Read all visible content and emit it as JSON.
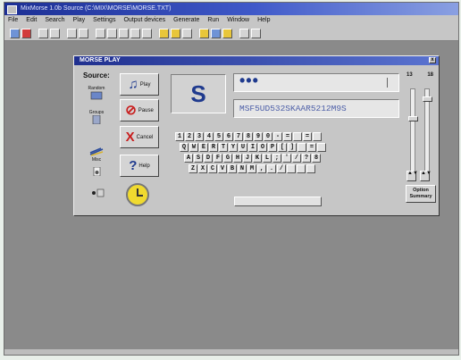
{
  "app": {
    "title": "MixMorse 1.0b Source (C:\\MIX\\MORSE\\MORSE.TXT)"
  },
  "menubar": [
    {
      "label": "File"
    },
    {
      "label": "Edit"
    },
    {
      "label": "Search"
    },
    {
      "label": "Play"
    },
    {
      "label": "Settings"
    },
    {
      "label": "Output devices"
    },
    {
      "label": "Generate"
    },
    {
      "label": "Run"
    },
    {
      "label": "Window"
    },
    {
      "label": "Help"
    }
  ],
  "dialog": {
    "title": "MORSE PLAY",
    "close_glyph": "x",
    "source_label": "Source:",
    "source_buttons": [
      {
        "label": "Random",
        "icon": "random-dice-icon"
      },
      {
        "label": "Groups",
        "icon": "groups-icon"
      },
      {
        "label": "Misc",
        "icon": "misc-icon"
      },
      {
        "label": "",
        "icon": "file-icon"
      },
      {
        "label": "",
        "icon": "toggle-icon"
      }
    ],
    "commands": [
      {
        "label": "Play",
        "glyph": "♫",
        "icon": "play-music-icon",
        "color": "#1f3a8e"
      },
      {
        "label": "Pause",
        "glyph": "⊘",
        "icon": "pause-circle-icon",
        "color": "#c81e1e"
      },
      {
        "label": "Cancel",
        "glyph": "X",
        "icon": "cancel-x-icon",
        "color": "#c81e1e"
      },
      {
        "label": "Help",
        "glyph": "?",
        "icon": "help-question-icon",
        "color": "#1f3a8e"
      }
    ],
    "current_char": "S",
    "morse_code": "•••",
    "text_output": "MSF5UD532SKAAR5212M9S",
    "keyboard": {
      "row1": [
        "1",
        "2",
        "3",
        "4",
        "5",
        "6",
        "7",
        "8",
        "9",
        "0",
        "-",
        "=",
        "",
        "=",
        ""
      ],
      "row2": [
        "Q",
        "W",
        "E",
        "R",
        "T",
        "Y",
        "U",
        "I",
        "O",
        "P",
        "[",
        "]",
        "",
        "=",
        ""
      ],
      "row3": [
        "A",
        "S",
        "D",
        "F",
        "G",
        "H",
        "J",
        "K",
        "L",
        ";",
        "'",
        "/",
        "?",
        "8"
      ],
      "row4": [
        "Z",
        "X",
        "C",
        "V",
        "B",
        "N",
        "M",
        ",",
        ".",
        "/",
        "",
        "",
        ""
      ]
    },
    "speed": {
      "left": "13",
      "right": "18"
    },
    "options_button": {
      "line1": "Option",
      "line2": "Summary"
    },
    "colors": {
      "title_bar": "#20308f",
      "accent_blue": "#1f3a8e",
      "accent_red": "#c81e1e",
      "clock": "#f0da2f"
    }
  }
}
